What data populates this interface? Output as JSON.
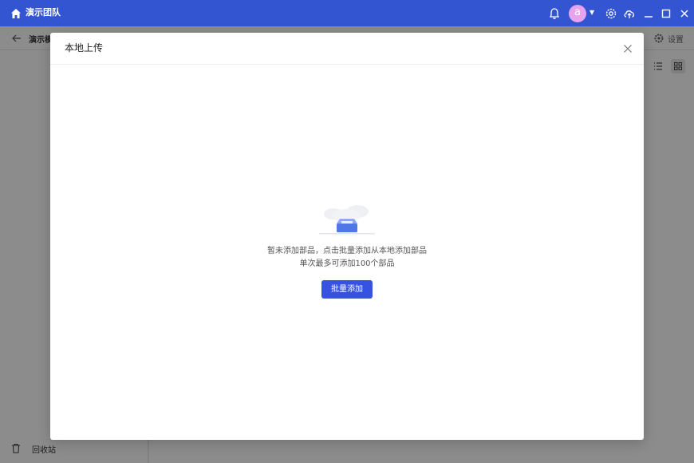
{
  "titlebar": {
    "team_name": "演示团队",
    "avatar_letter": "a",
    "accent_color": "#3355d1"
  },
  "background": {
    "breadcrumb": "演示模",
    "settings_label": "设置",
    "recycle_label": "回收站"
  },
  "modal": {
    "title": "本地上传",
    "empty_line1": "暂未添加部品，点击批量添加从本地添加部品",
    "empty_line2": "单次最多可添加100个部品",
    "batch_add_label": "批量添加",
    "button_color": "#3553e0"
  }
}
